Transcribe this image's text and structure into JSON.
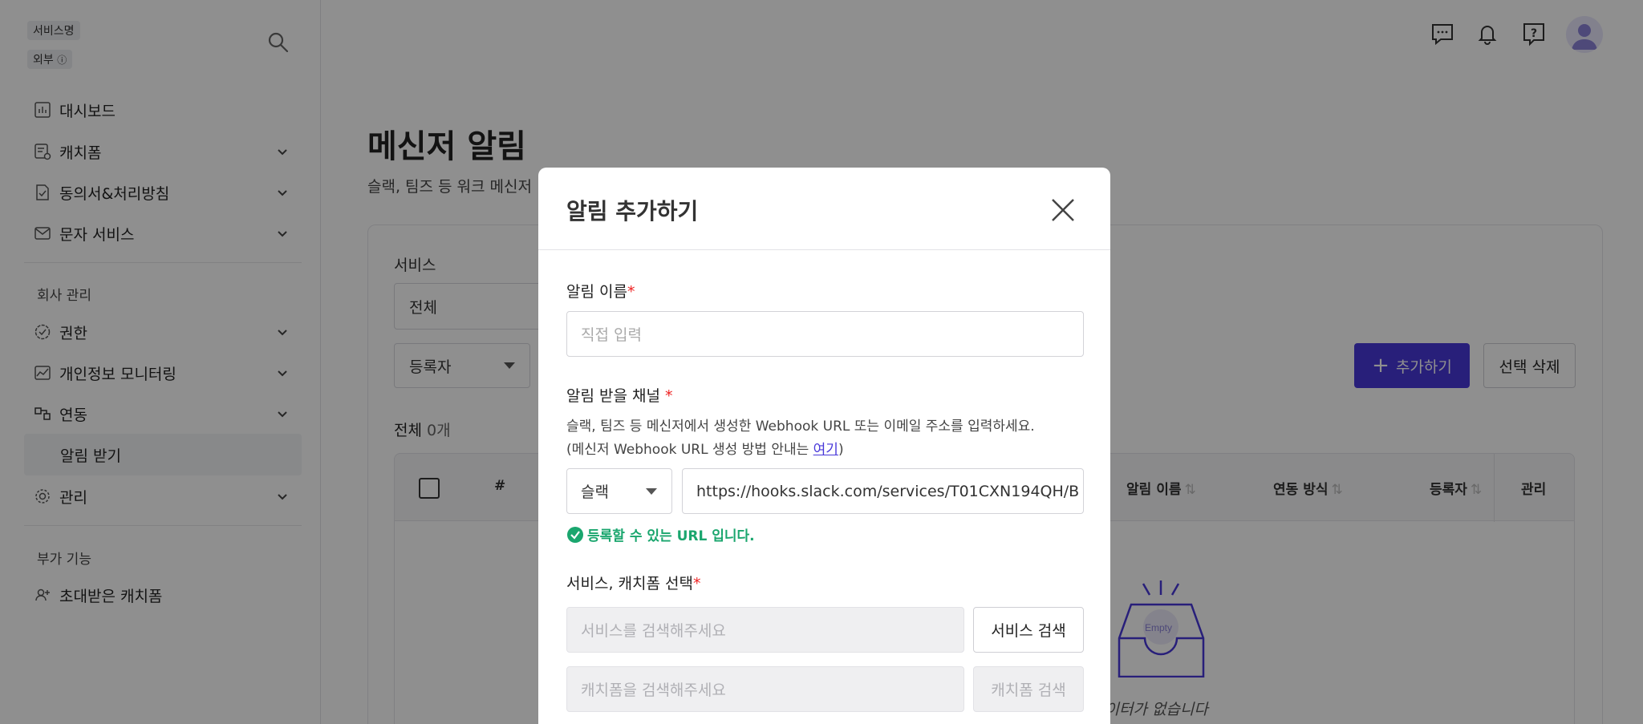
{
  "sidebar": {
    "service_tag": "서비스명",
    "external_tag": "외부",
    "nav": {
      "dashboard": "대시보드",
      "catchform": "캐치폼",
      "consent": "동의서&처리방침",
      "sms": "문자 서비스",
      "company_section": "회사 관리",
      "permission": "권한",
      "privacy_monitoring": "개인정보 모니터링",
      "integration": "연동",
      "receive_alerts": "알림 받기",
      "management": "관리",
      "extra_section": "부가 기능",
      "invited_catchform": "초대받은 캐치폼"
    }
  },
  "main": {
    "page_title": "메신저 알림",
    "page_desc": "슬랙, 팀즈 등 워크 메신저",
    "filter": {
      "service_label": "서비스",
      "service_value": "전체",
      "registrant_value": "등록자"
    },
    "add_button": "추가하기",
    "delete_button": "선택 삭제",
    "count_label": "전체",
    "count_value": "0개",
    "table": {
      "columns": {
        "index": "#",
        "alert_name": "알림 이름",
        "method": "연동 방식",
        "registrant": "등록자",
        "manage": "관리"
      }
    },
    "empty": {
      "badge": "Empty",
      "text": "데이터가 없습니다"
    }
  },
  "modal": {
    "title": "알림 추가하기",
    "name_label": "알림 이름",
    "required_mark": "*",
    "name_placeholder": "직접 입력",
    "channel_label": "알림 받을 채널",
    "channel_help_1": "슬랙, 팀즈 등 메신저에서 생성한 Webhook URL 또는 이메일 주소를 입력하세요.",
    "channel_help_2_prefix": "(메신저 Webhook URL 생성 방법 안내는 ",
    "channel_help_link": "여기",
    "channel_help_2_suffix": ")",
    "channel_type": "슬랙",
    "webhook_url": "https://hooks.slack.com/services/T01CXN194QH/B",
    "valid_message": "등록할 수 있는 URL 입니다.",
    "service_label": "서비스, 캐치폼 선택",
    "service_placeholder": "서비스를 검색해주세요",
    "service_search_button": "서비스 검색",
    "catchform_placeholder": "캐치폼을 검색해주세요",
    "catchform_search_button": "캐치폼 검색"
  },
  "colors": {
    "primary": "#4838d9",
    "success": "#1aa66e",
    "required": "#e22222"
  }
}
